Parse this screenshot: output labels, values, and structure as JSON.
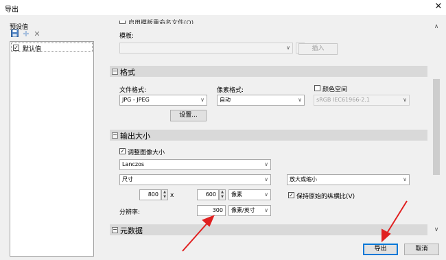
{
  "window": {
    "title": "导出"
  },
  "presets": {
    "label": "预设值",
    "items": [
      {
        "label": "默认值",
        "checked": true
      }
    ]
  },
  "template": {
    "top_option": "启用模板重命名文件(O)",
    "label": "模板:",
    "insert_button": "插入"
  },
  "format_section": {
    "title": "格式",
    "file_format_label": "文件格式:",
    "file_format_value": "JPG - JPEG",
    "pixel_format_label": "像素格式:",
    "pixel_format_value": "自动",
    "color_space_label": "颜色空间",
    "color_space_checked": false,
    "color_space_value": "sRGB IEC61966-2.1",
    "settings_button": "设置..."
  },
  "size_section": {
    "title": "输出大小",
    "resize_label": "调整图像大小",
    "resize_checked": true,
    "resample_value": "Lanczos",
    "mode_value": "尺寸",
    "scale_value": "放大或缩小",
    "width": "800",
    "times": "x",
    "height": "600",
    "unit_value": "像素",
    "keep_ratio_label": "保持原始的纵横比(V)",
    "keep_ratio_checked": true,
    "resolution_label": "分辨率:",
    "resolution_value": "300",
    "resolution_unit": "像素/英寸"
  },
  "metadata_section": {
    "title": "元数据"
  },
  "footer": {
    "export_button": "导出",
    "cancel_button": "取消"
  },
  "annotation_color": "#e02020"
}
